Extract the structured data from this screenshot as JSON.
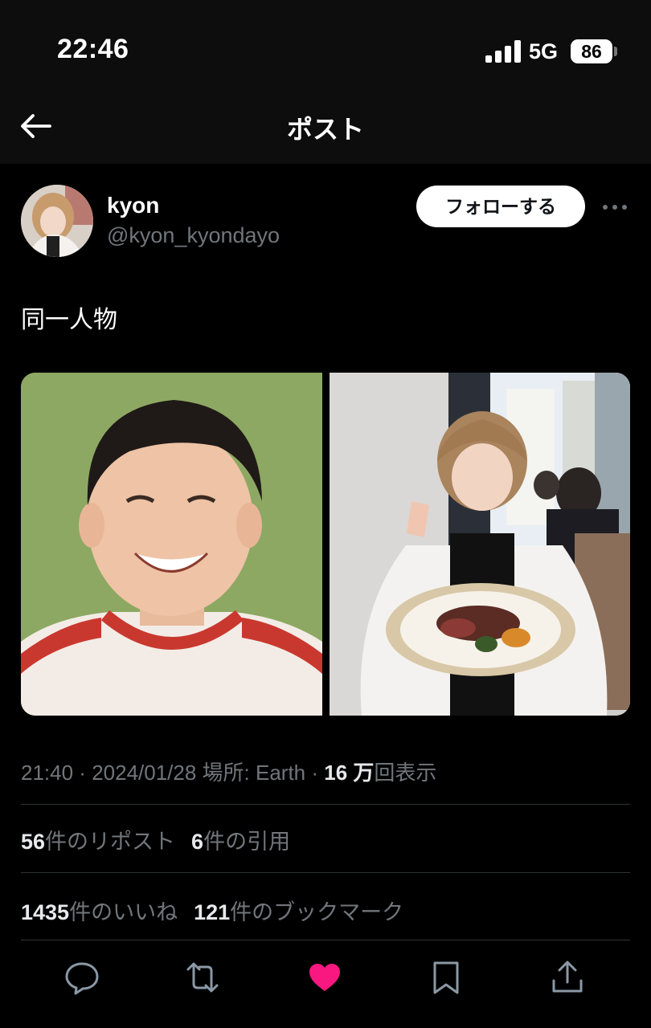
{
  "status_bar": {
    "time": "22:46",
    "network": "5G",
    "battery": "86"
  },
  "header": {
    "title": "ポスト",
    "back_icon": "arrow-left-icon"
  },
  "post": {
    "display_name": "kyon",
    "handle": "@kyon_kyondayo",
    "follow_label": "フォローする",
    "text": "同一人物",
    "meta": {
      "time": "21:40",
      "sep1": " · ",
      "date": "2024/01/28",
      "place_label": " 場所: Earth",
      "sep2": " · ",
      "views_count": "16 万",
      "views_label": "回表示"
    },
    "stats": {
      "reposts_count": "56",
      "reposts_label": "件のリポスト",
      "quotes_count": "6",
      "quotes_label": "件の引用",
      "likes_count": "1435",
      "likes_label": "件のいいね",
      "bookmarks_count": "121",
      "bookmarks_label": "件のブックマーク"
    }
  },
  "actions": [
    {
      "icon": "reply-icon"
    },
    {
      "icon": "repost-icon"
    },
    {
      "icon": "like-icon",
      "active": true,
      "color": "#f91880"
    },
    {
      "icon": "bookmark-icon"
    },
    {
      "icon": "share-icon"
    }
  ],
  "colors": {
    "background": "#000000",
    "secondary_text": "#71767b",
    "like": "#f91880"
  }
}
